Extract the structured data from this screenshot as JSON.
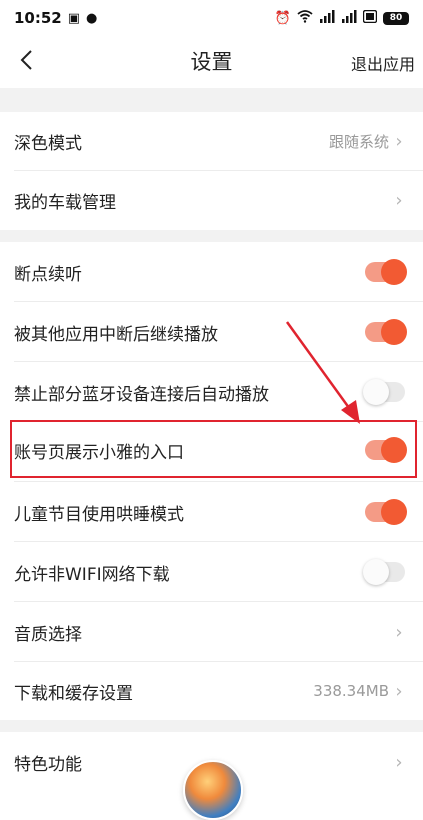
{
  "status_bar": {
    "time": "10:52",
    "battery": "80",
    "icons": [
      "sim-icon",
      "message-icon",
      "alarm-icon",
      "wifi-icon",
      "signal-icon",
      "signal-icon",
      "data-icon",
      "battery-icon"
    ]
  },
  "header": {
    "title": "设置",
    "exit_label": "退出应用"
  },
  "sections": [
    {
      "rows": [
        {
          "label": "深色模式",
          "value": "跟随系统",
          "type": "link"
        },
        {
          "label": "我的车载管理",
          "value": "",
          "type": "link"
        }
      ]
    },
    {
      "rows": [
        {
          "label": "断点续听",
          "type": "toggle",
          "on": true
        },
        {
          "label": "被其他应用中断后继续播放",
          "type": "toggle",
          "on": true
        },
        {
          "label": "禁止部分蓝牙设备连接后自动播放",
          "type": "toggle",
          "on": false
        },
        {
          "label": "账号页展示小雅的入口",
          "type": "toggle",
          "on": true
        },
        {
          "label": "儿童节目使用哄睡模式",
          "type": "toggle",
          "on": true
        },
        {
          "label": "允许非WIFI网络下载",
          "type": "toggle",
          "on": false
        },
        {
          "label": "音质选择",
          "value": "",
          "type": "link"
        },
        {
          "label": "下载和缓存设置",
          "value": "338.34MB",
          "type": "link"
        }
      ]
    },
    {
      "rows": [
        {
          "label": "特色功能",
          "value": "",
          "type": "link"
        }
      ]
    }
  ],
  "colors": {
    "accent": "#f25a33",
    "toggle_track_on": "#f49b86",
    "annotation": "#e0242f"
  }
}
